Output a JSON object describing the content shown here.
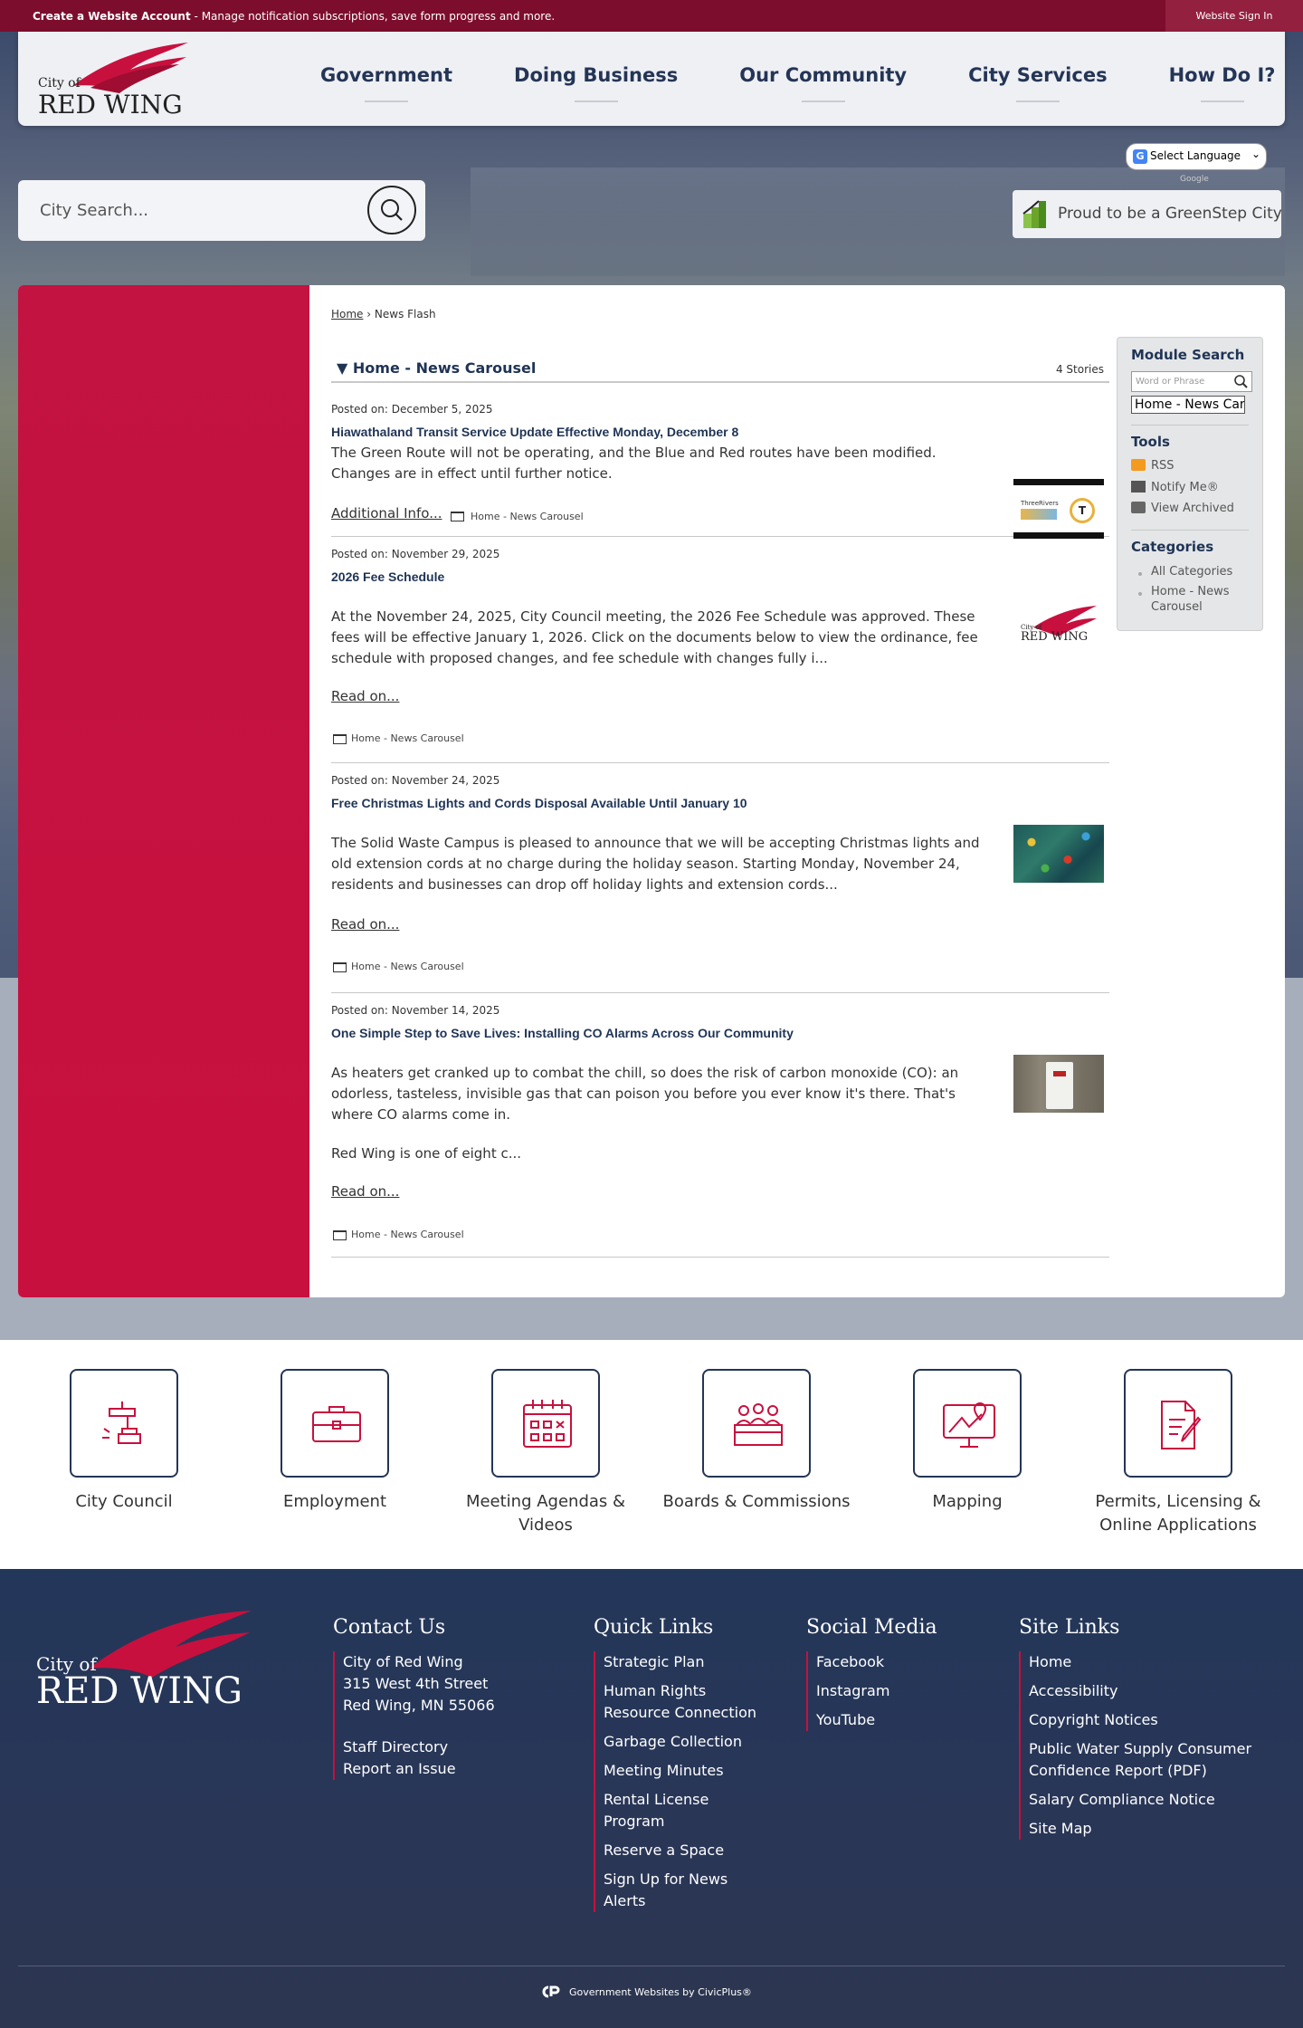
{
  "topbar": {
    "create_label": "Create a Website Account",
    "create_desc": "- Manage notification subscriptions, save form progress and more.",
    "signin_label": "Website Sign In"
  },
  "logo": {
    "city_of": "City of",
    "name": "RED WING"
  },
  "nav": [
    "Government",
    "Doing Business",
    "Our Community",
    "City Services",
    "How Do I?"
  ],
  "search": {
    "placeholder": "City Search...",
    "icon": "search-icon"
  },
  "translate": {
    "label": "Select Language",
    "powered": "Google"
  },
  "greenstep": {
    "label": "Proud to be a GreenStep City"
  },
  "breadcrumb": {
    "home": "Home",
    "separator": "›",
    "current": "News Flash"
  },
  "feed": {
    "title": "Home - News Carousel",
    "count": "4 Stories",
    "stories": [
      {
        "date": "Posted on: December 5, 2025",
        "title": "Hiawathaland Transit Service Update Effective Monday, December 8",
        "body": "The Green Route will not be operating, and the Blue and Red routes have been modified. Changes are in effect until further notice.",
        "more": "Additional Info...",
        "category": "Home - News Carousel"
      },
      {
        "date": "Posted on: November 29, 2025",
        "title": "2026 Fee Schedule",
        "body": "At the November 24, 2025, City Council meeting, the 2026 Fee Schedule was approved. These fees will be effective January 1, 2026. Click on the documents below to view the ordinance, fee schedule with proposed changes, and fee schedule with changes fully i...",
        "more": "Read on...",
        "category": "Home - News Carousel"
      },
      {
        "date": "Posted on: November 24, 2025",
        "title": "Free Christmas Lights and Cords Disposal Available Until January 10",
        "body": "The Solid Waste Campus is pleased to announce that we will be accepting Christmas lights and old extension cords at no charge during the holiday season. Starting Monday, November 24, residents and businesses can drop off holiday lights and extension cords...",
        "more": "Read on...",
        "category": "Home - News Carousel"
      },
      {
        "date": "Posted on: November 14, 2025",
        "title": "One Simple Step to Save Lives: Installing CO Alarms Across Our Community",
        "body": "As heaters get cranked up to combat the chill, so does the risk of carbon monoxide (CO): an odorless, tasteless, invisible gas that can poison you before you ever know it's there. That's where CO alarms come in.",
        "body2": "Red Wing is one of eight c...",
        "more": "Read on...",
        "category": "Home - News Carousel"
      }
    ]
  },
  "thumb1": {
    "brand": "ThreeRivers",
    "badge": "T"
  },
  "sidepanel": {
    "module_search_title": "Module Search",
    "search_placeholder": "Word or Phrase",
    "select_value": "Home - News Carousel",
    "tools_title": "Tools",
    "tools": [
      "RSS",
      "Notify Me®",
      "View Archived"
    ],
    "categories_title": "Categories",
    "categories": [
      "All Categories",
      "Home - News Carousel"
    ]
  },
  "quick_links": [
    {
      "label": "City Council",
      "icon": "gavel-icon"
    },
    {
      "label": "Employment",
      "icon": "briefcase-icon"
    },
    {
      "label": "Meeting Agendas & Videos",
      "icon": "calendar-icon"
    },
    {
      "label": "Boards & Commissions",
      "icon": "people-icon"
    },
    {
      "label": "Mapping",
      "icon": "map-monitor-icon"
    },
    {
      "label": "Permits, Licensing & Online Applications",
      "icon": "document-pen-icon"
    }
  ],
  "footer": {
    "contact": {
      "title": "Contact Us",
      "address": [
        "City of Red Wing",
        "315 West 4th Street",
        "Red Wing, MN 55066"
      ],
      "links": [
        "Staff Directory",
        "Report an Issue"
      ]
    },
    "quick": {
      "title": "Quick Links",
      "links": [
        "Strategic Plan",
        "Human Rights Resource Connection",
        "Garbage Collection",
        "Meeting Minutes",
        "Rental License Program",
        "Reserve a Space",
        "Sign Up for News Alerts"
      ]
    },
    "social": {
      "title": "Social Media",
      "links": [
        "Facebook",
        "Instagram",
        "YouTube"
      ]
    },
    "site": {
      "title": "Site Links",
      "links": [
        "Home",
        "Accessibility",
        "Copyright Notices",
        "Public Water Supply Consumer Confidence Report (PDF)",
        "Salary Compliance Notice",
        "Site Map"
      ]
    },
    "credit": "Government Websites by CivicPlus®"
  },
  "colors": {
    "brand_red": "#c8103e",
    "navy": "#243556",
    "topbar": "#7d0d2c"
  }
}
